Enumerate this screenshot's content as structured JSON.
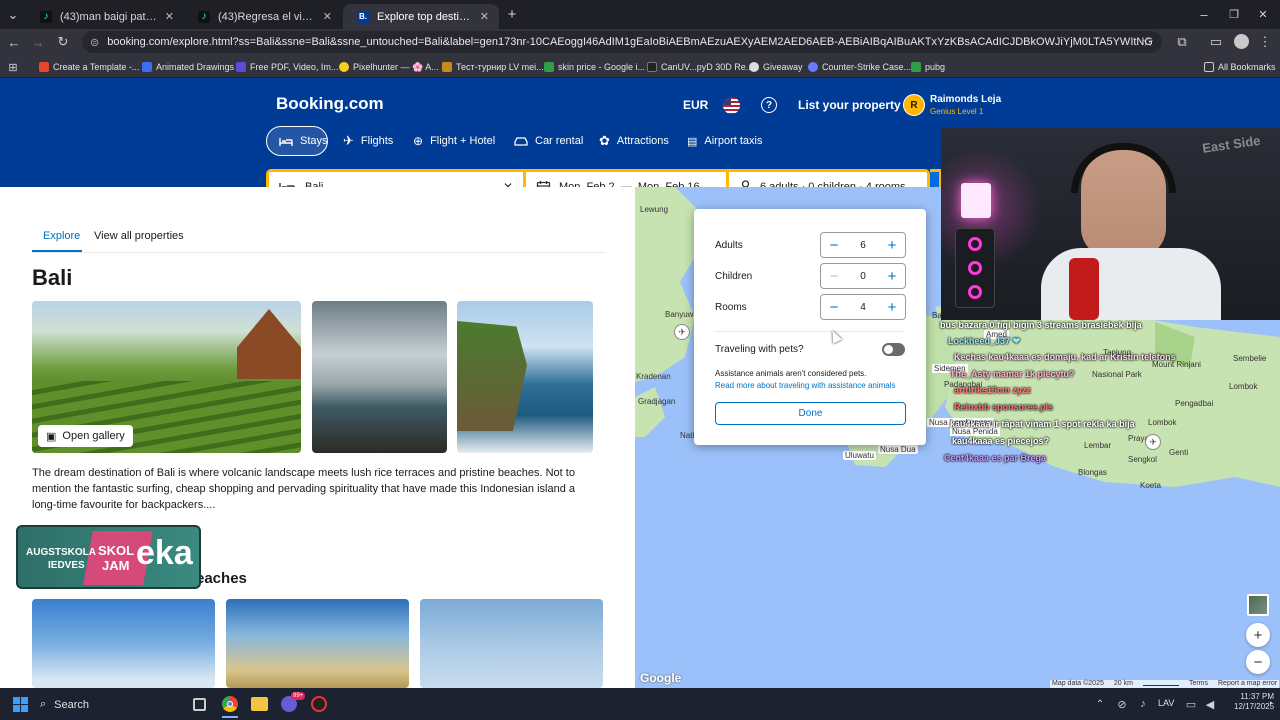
{
  "browser": {
    "tabs": [
      {
        "title": "(43)man baigi patika, bet viņa b",
        "icon": "tiktok-icon",
        "active": false
      },
      {
        "title": "(43)Regresa el viejo Instagram",
        "icon": "tiktok-icon",
        "active": false
      },
      {
        "title": "Explore top destinations for yo",
        "icon": "booking-icon",
        "favicon_letter": "B.",
        "active": true
      }
    ],
    "new_tab": "+",
    "url": "booking.com/explore.html?ss=Bali&ssne=Bali&ssne_untouched=Bali&label=gen173nr-10CAEoggI46AdIM1gEaIoBiAEBmAEzuAEXyAEM2AED6AEB-AEBiAIBqAIBuAKTxYzKBsACAdICJDBkOWJiYjM0LTA5YWItNGZiZC1iY2M4LWY1OTEzNGQzOTVjNNgCaAMBoAIBugIYx",
    "bookmarks": [
      {
        "label": "Create a Template -...",
        "color": "#e6462e"
      },
      {
        "label": "Animated Drawings",
        "color": "#3b6ef5"
      },
      {
        "label": "Free PDF, Video, Im...",
        "color": "#5b4bd6"
      },
      {
        "label": "Pixelhunter — 🌸 A...",
        "color": "#f5d020"
      },
      {
        "label": "Тест-турнир LV mei...",
        "color": "#c88a18"
      },
      {
        "label": "skin price - Google i...",
        "color": "#2ea043"
      },
      {
        "label": "CanUV...pyD 30D Re...",
        "color": "#222222"
      },
      {
        "label": "Giveaway",
        "color": "#dddddd"
      },
      {
        "label": "Counter-Strike Case...",
        "color": "#6b7bff"
      },
      {
        "label": "pubg",
        "color": "#2ea043"
      }
    ],
    "all_bookmarks": "All Bookmarks"
  },
  "header": {
    "logo": "Booking.com",
    "currency": "EUR",
    "list_property": "List your property",
    "user_initial": "R",
    "user_name": "Raimonds Leja",
    "user_level": "Genius Level 1",
    "nav": [
      {
        "label": "Stays",
        "icon": "bed-icon",
        "active": true
      },
      {
        "label": "Flights",
        "icon": "plane-icon",
        "active": false
      },
      {
        "label": "Flight + Hotel",
        "icon": "flight-hotel-icon",
        "active": false
      },
      {
        "label": "Car rental",
        "icon": "car-icon",
        "active": false
      },
      {
        "label": "Attractions",
        "icon": "attractions-icon",
        "active": false
      },
      {
        "label": "Airport taxis",
        "icon": "taxi-icon",
        "active": false
      }
    ]
  },
  "search": {
    "destination": "Bali",
    "dates": "Mon, Feb 2  —  Mon, Feb 16",
    "guests": "6 adults · 0 children · 4 rooms"
  },
  "content": {
    "tabs": [
      "Explore",
      "View all properties"
    ],
    "heading": "Bali",
    "open_gallery": "Open gallery",
    "description": "The dream destination of Bali is where volcanic landscape meets lush rice terraces and pristine beaches. Not to mention the fantastic surfing, cheap shopping and pervading spirituality that have made this Indonesian island a long-time favourite for backpackers....",
    "section_heading_partial": "eaches"
  },
  "popup": {
    "adults_label": "Adults",
    "adults_value": "6",
    "children_label": "Children",
    "children_value": "0",
    "rooms_label": "Rooms",
    "rooms_value": "4",
    "pets_label": "Traveling with pets?",
    "pets_note": "Assistance animals aren't considered pets.",
    "pets_link": "Read more about traveling with assistance animals",
    "done": "Done"
  },
  "map": {
    "labels": [
      "Lewung",
      "Banyuwa",
      "Kradenan",
      "Gradjagan",
      "Nati",
      "Nusa Dua",
      "Uluwatu",
      "Amed",
      "Sidemen",
      "Padangbai",
      "Nusa Lembongan",
      "Nusa Penida",
      "Tanjung",
      "Nasional Park",
      "Sembelie",
      "Lombok",
      "Mount Rinjani",
      "Pengadbai",
      "Praya",
      "Lembar",
      "Sengkol",
      "Genti",
      "Blongas",
      "Koeta",
      "Lombok",
      "Bali"
    ],
    "footer": [
      "Map data ©2025",
      "20 km",
      "Terms",
      "Report a map error"
    ],
    "google": "Google"
  },
  "stream_overlay": {
    "chat": [
      "bus bazara 0 figi bigin 3 streams brasiebek bija",
      "Lockheed_J37  ❤",
      "Kechas  kau4kaaa es domaju, kad ar Kristin telefons",
      "The_Asty  mamar 1k piecytu?",
      "arturiks19cm  zyzz",
      "Reinxbb  sponsoree.pls",
      "kau4kaaa  ir tāpat vīņam 1 spot rekla ka bija",
      "kau4kaaa  es piecejos?",
      "Cent4kaaa  es par Brega"
    ],
    "banner_text1": "AUGSTSKOLA",
    "banner_text2": "IEDVES",
    "banner_brand1": "SKOL",
    "banner_brand2": "JAM",
    "banner_big": "eka",
    "webcam_wall_text": "East Side"
  },
  "taskbar": {
    "search": "Search",
    "badge": "99+",
    "lang": "LAV",
    "time": "11:37 PM",
    "date": "12/17/2025"
  },
  "colors": {
    "booking_blue": "#003b95",
    "accent_yellow": "#ffb700",
    "link_blue": "#0071c2"
  }
}
